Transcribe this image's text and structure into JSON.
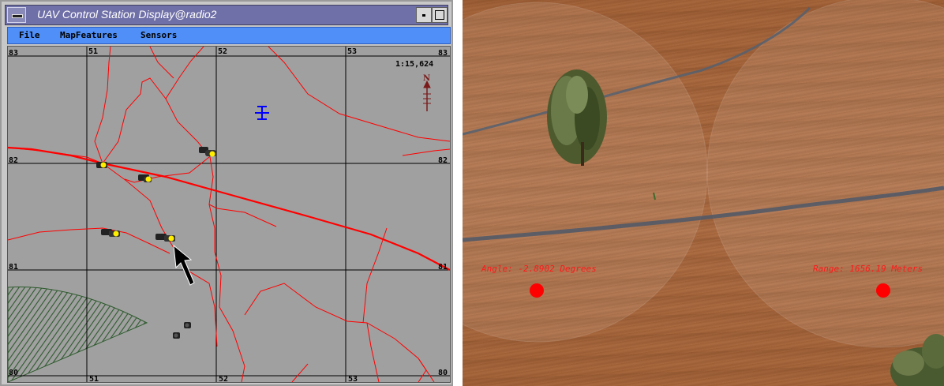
{
  "window": {
    "title": "UAV Control Station Display@radio2"
  },
  "menu": {
    "items": [
      "File",
      "MapFeatures",
      "Sensors"
    ]
  },
  "map": {
    "scale": "1:15,624",
    "grid_top": [
      "51",
      "52",
      "53"
    ],
    "grid_bottom": [
      "51",
      "52",
      "53"
    ],
    "grid_left": [
      "83",
      "82",
      "81",
      "80"
    ],
    "grid_right": [
      "83",
      "82",
      "81",
      "80"
    ],
    "north_label": "N",
    "road_color": "#ff0000",
    "background_color": "#a0a0a0",
    "uav_icon": "uav-aircraft-icon",
    "vehicle_icon": "vehicle-icon",
    "cursor_icon": "arrow-cursor-icon"
  },
  "sensor": {
    "angle_readout": "Angle: -2.8902 Degrees",
    "range_readout": "Range: 1656.19 Meters",
    "readout_color": "#ff1a1a"
  }
}
